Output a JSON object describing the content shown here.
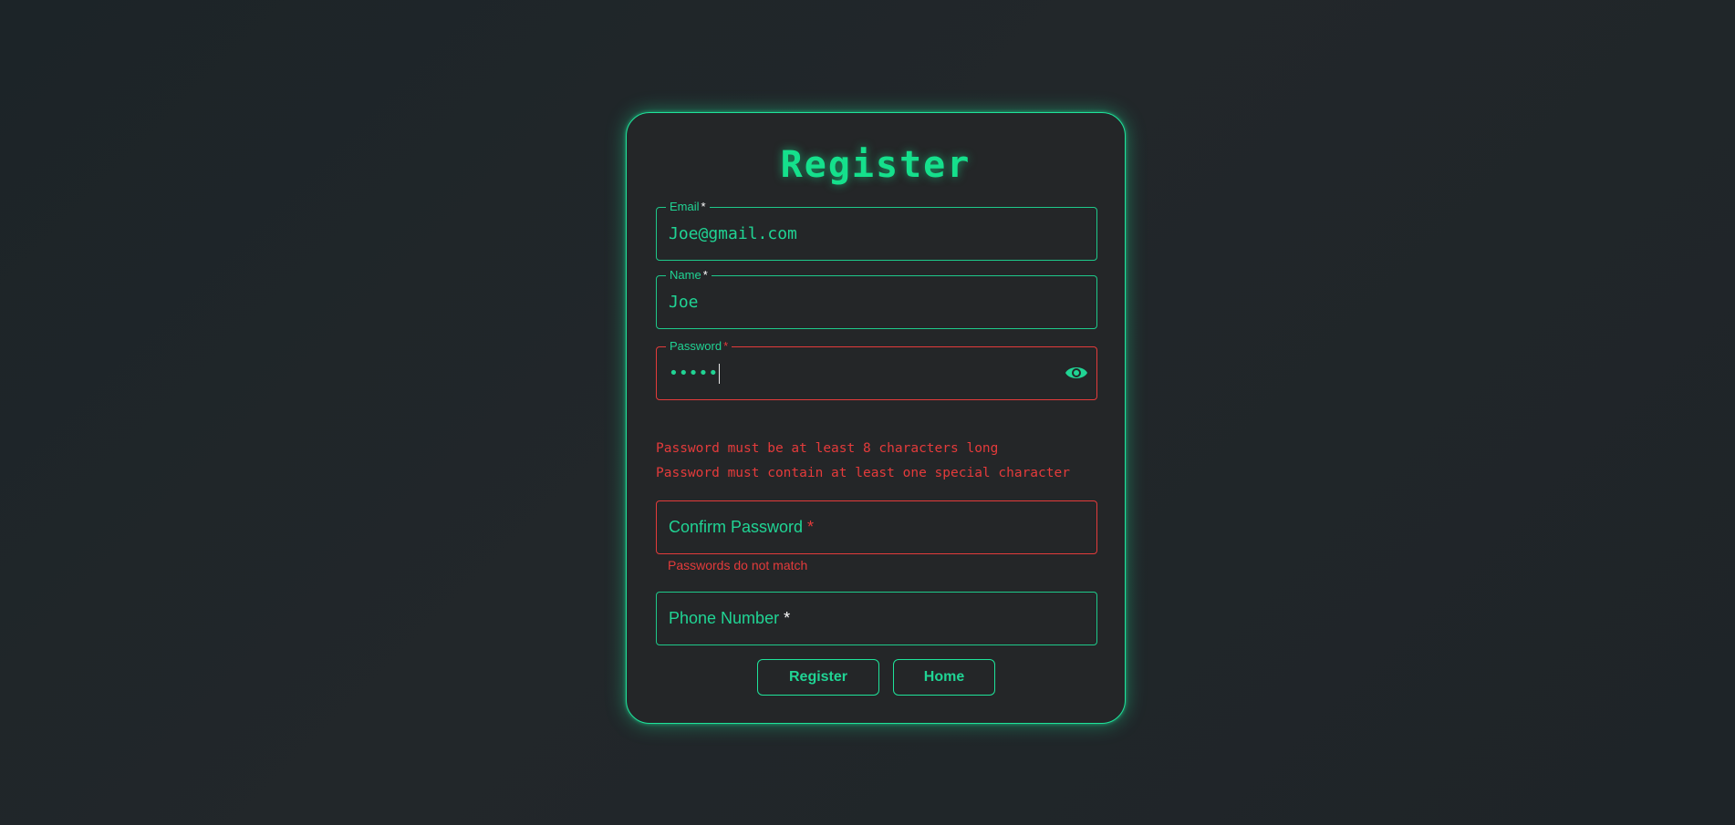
{
  "title": "Register",
  "fields": {
    "email": {
      "label": "Email",
      "required_mark": "*",
      "value": "Joe@gmail.com"
    },
    "name": {
      "label": "Name",
      "required_mark": "*",
      "value": "Joe"
    },
    "password": {
      "label": "Password",
      "required_mark": "*",
      "value": "•••••"
    },
    "confirm_password": {
      "label": "Confirm Password",
      "required_mark": "*",
      "helper": "Passwords do not match"
    },
    "phone": {
      "label": "Phone Number",
      "required_mark": "*"
    }
  },
  "password_errors": [
    "Password must be at least 8 characters long",
    "Password must contain at least one special character"
  ],
  "buttons": {
    "register": "Register",
    "home": "Home"
  },
  "icons": {
    "password_toggle": "eye-icon"
  },
  "colors": {
    "accent": "#20d494",
    "error": "#e43b3b",
    "card_bg": "#242628",
    "page_bg": "#1f2528"
  }
}
